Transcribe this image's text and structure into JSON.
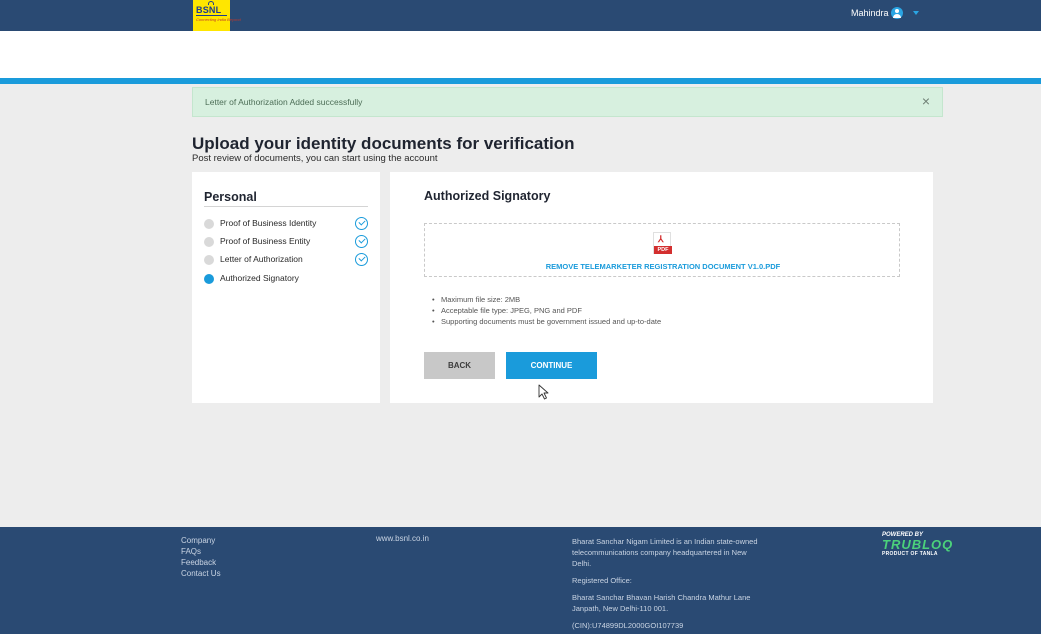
{
  "header": {
    "logo_text": "BSNL",
    "logo_tagline": "Connecting India Beyond",
    "user_name": "Mahindra"
  },
  "alert": {
    "message": "Letter of Authorization Added successfully",
    "close_glyph": "×"
  },
  "page": {
    "title": "Upload your identity documents for verification",
    "subtitle": "Post review of documents, you can start using the account"
  },
  "sidebar": {
    "heading": "Personal",
    "steps": [
      {
        "label": "Proof of Business Identity",
        "completed": true,
        "active": false
      },
      {
        "label": "Proof of Business Entity",
        "completed": true,
        "active": false
      },
      {
        "label": "Letter of Authorization",
        "completed": true,
        "active": false
      },
      {
        "label": "Authorized Signatory",
        "completed": false,
        "active": true
      }
    ]
  },
  "upload": {
    "title": "Authorized Signatory",
    "file_icon": "pdf-icon",
    "file_tag": "PDF",
    "file_name": "REMOVE TELEMARKETER REGISTRATION DOCUMENT V1.0.PDF",
    "rules": [
      "Maximum file size: 2MB",
      "Acceptable file type: JPEG, PNG and PDF",
      "Supporting documents must be government issued and up-to-date"
    ],
    "back_label": "BACK",
    "continue_label": "CONTINUE"
  },
  "footer": {
    "links": [
      "Company",
      "FAQs",
      "Feedback",
      "Contact Us"
    ],
    "website": "www.bsnl.co.in",
    "about": "Bharat Sanchar Nigam Limited is an Indian state-owned telecommunications company headquartered in New Delhi.",
    "office_label": "Registered Office:",
    "office_address": "Bharat Sanchar Bhavan Harish Chandra Mathur Lane Janpath, New Delhi-110 001.",
    "cin": "(CIN):U74899DL2000GOI107739",
    "powered_by": "POWERED BY",
    "powered_brand": "TRUBLOQ",
    "powered_tagline": "PRODUCT OF TANLA"
  },
  "colors": {
    "header_bg": "#2a4a73",
    "accent": "#1a9bdb",
    "logo_bg": "#ffe600",
    "alert_bg": "#d7f0df",
    "page_bg": "#ededed",
    "pdf_red": "#d32f2f",
    "trubloq_green": "#4bd17b"
  }
}
